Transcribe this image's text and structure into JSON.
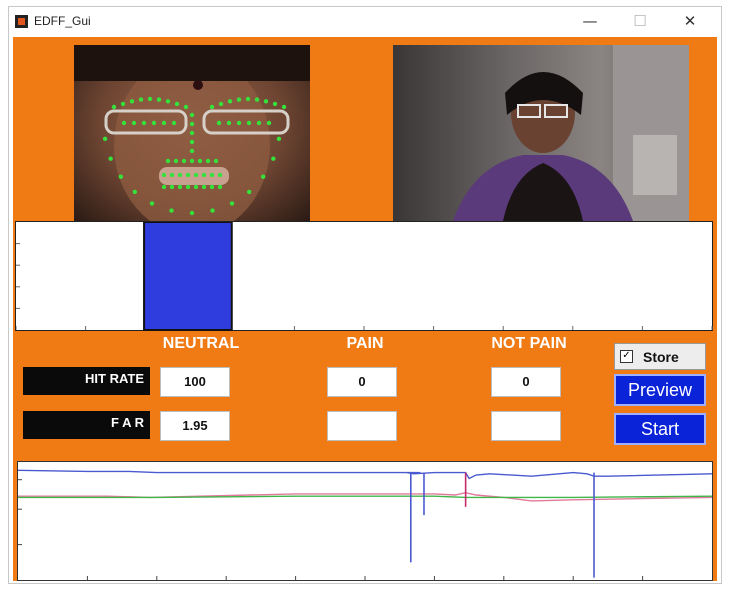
{
  "window": {
    "title": "EDFF_Gui"
  },
  "titlebar_icons": {
    "minimize": "minimize-icon",
    "maximize": "maximize-icon",
    "close": "close-icon"
  },
  "columns": {
    "neutral": "NEUTRAL",
    "pain": "PAIN",
    "not_pain": "NOT PAIN"
  },
  "rows": {
    "hit_rate": {
      "label": "HIT RATE",
      "neutral": "100",
      "pain": "0",
      "not_pain": "0"
    },
    "far": {
      "label": "F A R",
      "neutral": "1.95",
      "pain": "",
      "not_pain": ""
    }
  },
  "controls": {
    "store_label": "Store",
    "store_checked": true,
    "preview_label": "Preview",
    "start_label": "Start"
  },
  "colors": {
    "background": "#f07a14",
    "button": "#0a22d8",
    "bar": "#2f3ddf",
    "trace_blue": "#4a5ad0",
    "trace_pink": "#e07a9a",
    "trace_green": "#3fb54a"
  },
  "chart_data": [
    {
      "type": "bar",
      "categories": [
        "NEUTRAL",
        "PAIN",
        "NOT PAIN"
      ],
      "values": [
        1,
        0,
        0
      ],
      "ylim": [
        0,
        1
      ],
      "xlim": [
        0,
        10
      ],
      "bar_interval": [
        1.84,
        3.1
      ],
      "title": "",
      "xlabel": "",
      "ylabel": ""
    },
    {
      "type": "line",
      "title": "",
      "xlabel": "",
      "ylabel": "",
      "xlim": [
        0,
        10
      ],
      "ylim": [
        0,
        1
      ],
      "series": [
        {
          "color": "#4a5ad0",
          "x": [
            0,
            1,
            1.6,
            2,
            4,
            5.8,
            5.6,
            5.7,
            6.0,
            6.45,
            6.5,
            6.6,
            6.8,
            7.4,
            8,
            8.2,
            8.3,
            8.5,
            10
          ],
          "y": [
            0.93,
            0.92,
            0.92,
            0.91,
            0.91,
            0.91,
            0.91,
            0.9,
            0.91,
            0.91,
            0.86,
            0.89,
            0.9,
            0.88,
            0.91,
            0.9,
            0.88,
            0.88,
            0.9
          ]
        },
        {
          "color": "#e07a9a",
          "x": [
            0,
            1.3,
            1.9,
            4,
            5.5,
            6,
            6.3,
            6.45,
            6.6,
            7,
            7.4,
            8,
            9,
            10
          ],
          "y": [
            0.71,
            0.71,
            0.7,
            0.73,
            0.73,
            0.73,
            0.72,
            0.74,
            0.72,
            0.7,
            0.67,
            0.68,
            0.69,
            0.7
          ]
        },
        {
          "color": "#3fb54a",
          "x": [
            0,
            2,
            4,
            6,
            6.45,
            8,
            10
          ],
          "y": [
            0.7,
            0.7,
            0.71,
            0.71,
            0.7,
            0.7,
            0.71
          ]
        }
      ],
      "spikes": [
        {
          "x": 5.66,
          "y": 0.15,
          "color": "#4a5ad0"
        },
        {
          "x": 5.85,
          "y": 0.55,
          "color": "#4a5ad0"
        },
        {
          "x": 6.45,
          "y": 0.62,
          "color": "#c42a6a"
        },
        {
          "x": 8.3,
          "y": 0.02,
          "color": "#4a5ad0"
        }
      ]
    }
  ]
}
